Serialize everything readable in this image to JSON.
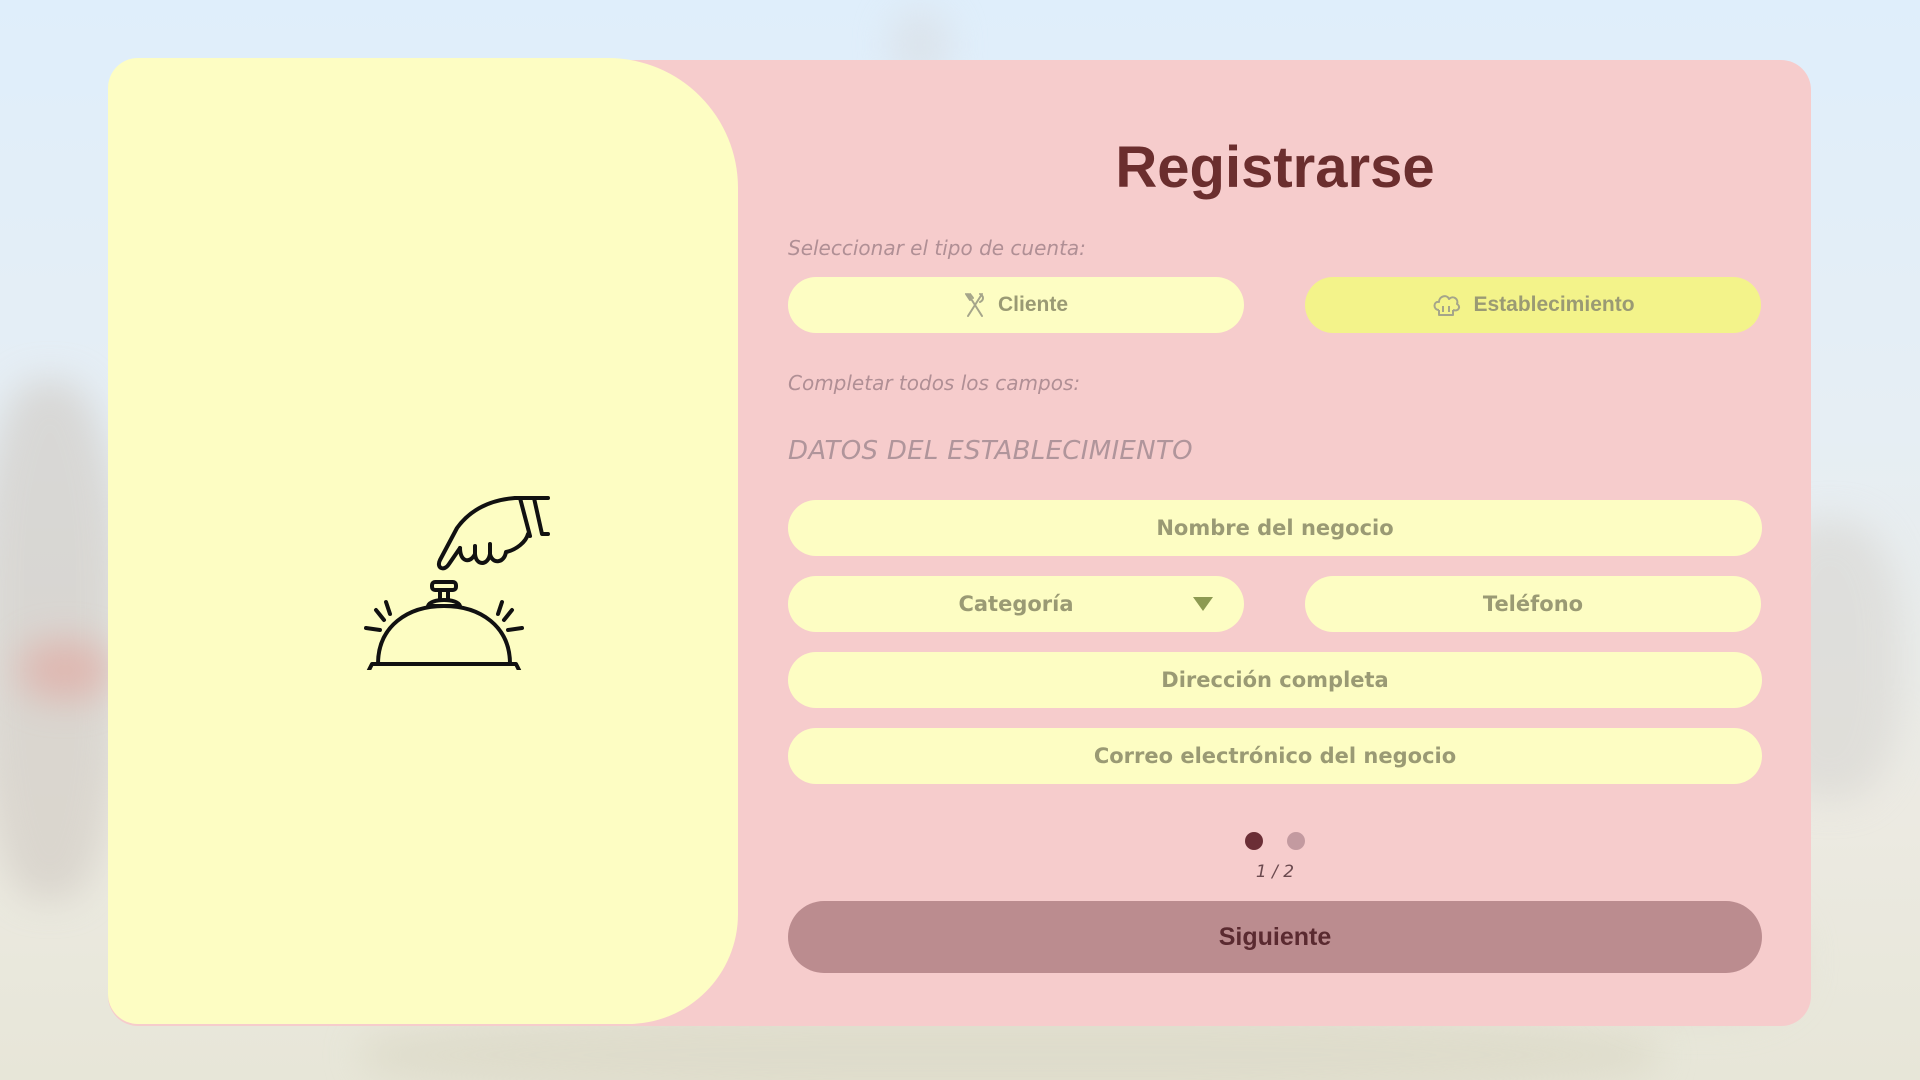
{
  "form": {
    "title": "Registrarse",
    "account_type_hint": "Seleccionar el tipo de cuenta:",
    "account_types": [
      {
        "label": "Cliente",
        "icon": "utensils-icon",
        "selected": false
      },
      {
        "label": "Establecimiento",
        "icon": "chef-hat-icon",
        "selected": true
      }
    ],
    "fields_hint": "Completar todos los campos:",
    "section_title": "DATOS DEL ESTABLECIMIENTO",
    "fields": {
      "business_name": "Nombre del negocio",
      "category": "Categoría",
      "phone": "Teléfono",
      "address": "Dirección completa",
      "email": "Correo electrónico del negocio"
    },
    "pagination": {
      "current": 1,
      "total": 2,
      "label": "1 / 2"
    },
    "next_label": "Siguiente"
  },
  "colors": {
    "card_bg": "#f6cccc",
    "panel_bg": "#fdfdc3",
    "active_pill": "#f3f38a",
    "title": "#6b2e2e",
    "button": "#bb8c8f"
  },
  "illustration": {
    "icon": "service-bell-icon"
  }
}
